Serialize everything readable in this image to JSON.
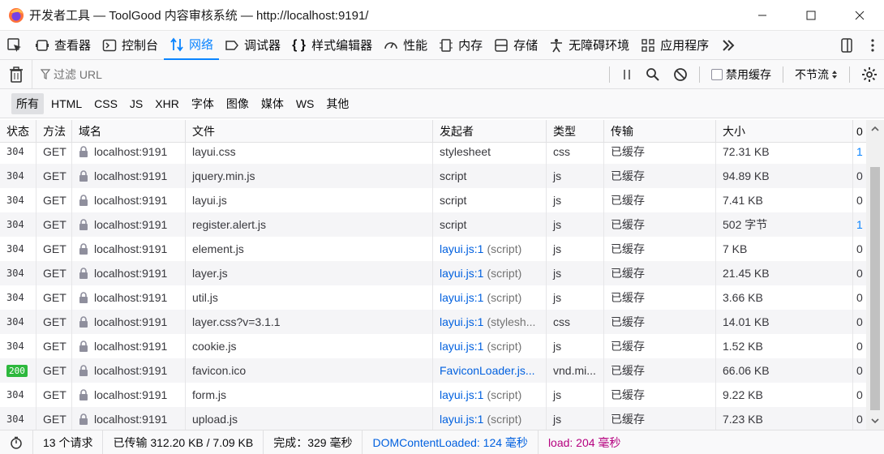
{
  "window": {
    "title": "开发者工具 — ToolGood 内容审核系统 — http://localhost:9191/",
    "app_icon": "firefox-icon"
  },
  "tabs": [
    {
      "label": "查看器",
      "icon": "inspector-icon"
    },
    {
      "label": "控制台",
      "icon": "console-icon"
    },
    {
      "label": "网络",
      "icon": "network-icon",
      "active": true
    },
    {
      "label": "调试器",
      "icon": "debugger-icon"
    },
    {
      "label": "样式编辑器",
      "icon": "style-editor-icon"
    },
    {
      "label": "性能",
      "icon": "performance-icon"
    },
    {
      "label": "内存",
      "icon": "memory-icon"
    },
    {
      "label": "存储",
      "icon": "storage-icon"
    },
    {
      "label": "无障碍环境",
      "icon": "accessibility-icon"
    },
    {
      "label": "应用程序",
      "icon": "application-icon"
    }
  ],
  "filterbar": {
    "placeholder": "过滤 URL",
    "disable_cache_label": "禁用缓存",
    "throttle_label": "不节流"
  },
  "type_filters": [
    "所有",
    "HTML",
    "CSS",
    "JS",
    "XHR",
    "字体",
    "图像",
    "媒体",
    "WS",
    "其他"
  ],
  "columns": [
    "状态",
    "方法",
    "域名",
    "文件",
    "发起者",
    "类型",
    "传输",
    "大小",
    "0"
  ],
  "rows": [
    {
      "status": "304",
      "method": "GET",
      "domain": "localhost:9191",
      "file": "layui.css",
      "initiator": "stylesheet",
      "initiator_link": "",
      "initiator_note": "",
      "type": "css",
      "transfer": "已缓存",
      "size": "72.31 KB",
      "bar": "1"
    },
    {
      "status": "304",
      "method": "GET",
      "domain": "localhost:9191",
      "file": "jquery.min.js",
      "initiator": "script",
      "initiator_link": "",
      "initiator_note": "",
      "type": "js",
      "transfer": "已缓存",
      "size": "94.89 KB",
      "bar": "0"
    },
    {
      "status": "304",
      "method": "GET",
      "domain": "localhost:9191",
      "file": "layui.js",
      "initiator": "script",
      "initiator_link": "",
      "initiator_note": "",
      "type": "js",
      "transfer": "已缓存",
      "size": "7.41 KB",
      "bar": "0"
    },
    {
      "status": "304",
      "method": "GET",
      "domain": "localhost:9191",
      "file": "register.alert.js",
      "initiator": "script",
      "initiator_link": "",
      "initiator_note": "",
      "type": "js",
      "transfer": "已缓存",
      "size": "502 字节",
      "bar": "1"
    },
    {
      "status": "304",
      "method": "GET",
      "domain": "localhost:9191",
      "file": "element.js",
      "initiator": "",
      "initiator_link": "layui.js:1",
      "initiator_note": "(script)",
      "type": "js",
      "transfer": "已缓存",
      "size": "7 KB",
      "bar": "0"
    },
    {
      "status": "304",
      "method": "GET",
      "domain": "localhost:9191",
      "file": "layer.js",
      "initiator": "",
      "initiator_link": "layui.js:1",
      "initiator_note": "(script)",
      "type": "js",
      "transfer": "已缓存",
      "size": "21.45 KB",
      "bar": "0"
    },
    {
      "status": "304",
      "method": "GET",
      "domain": "localhost:9191",
      "file": "util.js",
      "initiator": "",
      "initiator_link": "layui.js:1",
      "initiator_note": "(script)",
      "type": "js",
      "transfer": "已缓存",
      "size": "3.66 KB",
      "bar": "0"
    },
    {
      "status": "304",
      "method": "GET",
      "domain": "localhost:9191",
      "file": "layer.css?v=3.1.1",
      "initiator": "",
      "initiator_link": "layui.js:1",
      "initiator_note": "(stylesh...",
      "type": "css",
      "transfer": "已缓存",
      "size": "14.01 KB",
      "bar": "0"
    },
    {
      "status": "304",
      "method": "GET",
      "domain": "localhost:9191",
      "file": "cookie.js",
      "initiator": "",
      "initiator_link": "layui.js:1",
      "initiator_note": "(script)",
      "type": "js",
      "transfer": "已缓存",
      "size": "1.52 KB",
      "bar": "0"
    },
    {
      "status": "200",
      "method": "GET",
      "domain": "localhost:9191",
      "file": "favicon.ico",
      "initiator": "",
      "initiator_link": "FaviconLoader.js...",
      "initiator_note": "",
      "type": "vnd.mi...",
      "transfer": "已缓存",
      "size": "66.06 KB",
      "bar": "0"
    },
    {
      "status": "304",
      "method": "GET",
      "domain": "localhost:9191",
      "file": "form.js",
      "initiator": "",
      "initiator_link": "layui.js:1",
      "initiator_note": "(script)",
      "type": "js",
      "transfer": "已缓存",
      "size": "9.22 KB",
      "bar": "0"
    },
    {
      "status": "304",
      "method": "GET",
      "domain": "localhost:9191",
      "file": "upload.js",
      "initiator": "",
      "initiator_link": "layui.js:1",
      "initiator_note": "(script)",
      "type": "js",
      "transfer": "已缓存",
      "size": "7.23 KB",
      "bar": "0"
    }
  ],
  "statusbar": {
    "requests": "13 个请求",
    "transferred": "已传输 312.20 KB / 7.09 KB",
    "finish": "完成：329 毫秒",
    "dcl": "DOMContentLoaded: 124 毫秒",
    "load": "load: 204 毫秒"
  },
  "colors": {
    "accent": "#0a84ff",
    "link": "#0060df",
    "status_ok": "#2db83d",
    "load": "#b5007f"
  }
}
